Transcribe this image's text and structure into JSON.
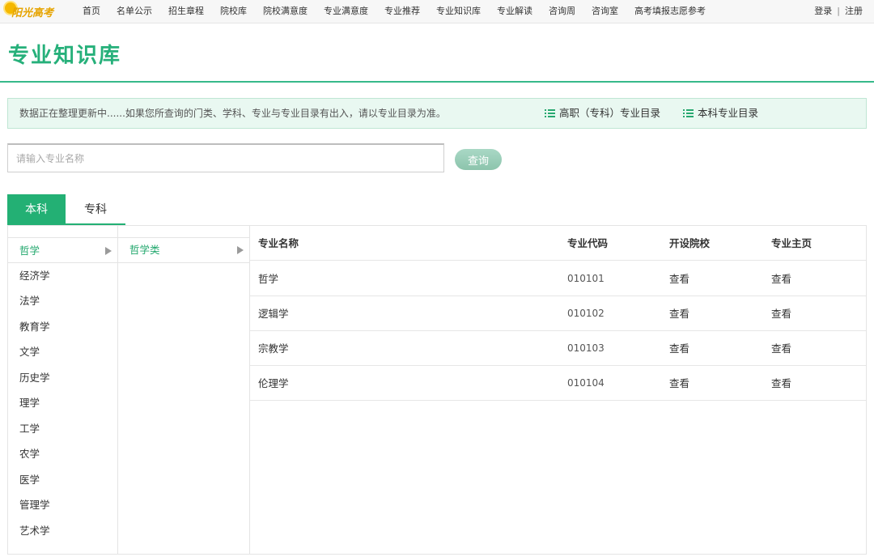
{
  "brand": {
    "logo_text": "阳光高考"
  },
  "nav": {
    "items": [
      "首页",
      "名单公示",
      "招生章程",
      "院校库",
      "院校满意度",
      "专业满意度",
      "专业推荐",
      "专业知识库",
      "专业解读",
      "咨询周",
      "咨询室",
      "高考填报志愿参考"
    ],
    "login": "登录",
    "separator": "|",
    "register": "注册"
  },
  "page": {
    "title": "专业知识库"
  },
  "notice": {
    "text": "数据正在整理更新中......如果您所查询的门类、学科、专业与专业目录有出入，请以专业目录为准。",
    "link_vocational": "高职（专科）专业目录",
    "link_undergrad": "本科专业目录"
  },
  "search": {
    "placeholder": "请输入专业名称",
    "button": "查询"
  },
  "tabs": {
    "benke": "本科",
    "zhuanke": "专科"
  },
  "categories": [
    "哲学",
    "经济学",
    "法学",
    "教育学",
    "文学",
    "历史学",
    "理学",
    "工学",
    "农学",
    "医学",
    "管理学",
    "艺术学"
  ],
  "subcategories": [
    "哲学类"
  ],
  "table": {
    "headers": [
      "专业名称",
      "专业代码",
      "开设院校",
      "专业主页"
    ],
    "rows": [
      {
        "name": "哲学",
        "code": "010101",
        "schools": "查看",
        "home": "查看"
      },
      {
        "name": "逻辑学",
        "code": "010102",
        "schools": "查看",
        "home": "查看"
      },
      {
        "name": "宗教学",
        "code": "010103",
        "schools": "查看",
        "home": "查看"
      },
      {
        "name": "伦理学",
        "code": "010104",
        "schools": "查看",
        "home": "查看"
      }
    ]
  },
  "colors": {
    "accent": "#23b074",
    "title": "#26b07a",
    "notice_bg": "#e9f8f1"
  },
  "icons": {
    "notice_links": "list-icon",
    "menu_arrow": "triangle-right-icon"
  }
}
